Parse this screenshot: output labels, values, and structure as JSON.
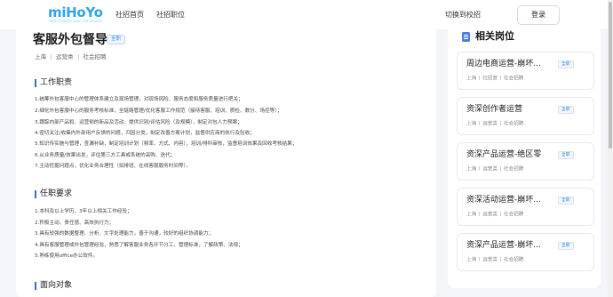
{
  "header": {
    "logo": {
      "brand": "miHoYo",
      "tagline": "TECH OTAKUS SAVE THE WORLD"
    },
    "nav": [
      {
        "label": "社招首页"
      },
      {
        "label": "社招职位"
      }
    ],
    "switch_label": "切换到校招",
    "login_label": "登录"
  },
  "job": {
    "title": "客服外包督导",
    "badge": "全职",
    "location": "上海",
    "category": "运营类",
    "recruit_type": "社会招聘",
    "duties_title": "工作职责",
    "duties": [
      "1.统筹外包客服中心的管理体系建立及现场管理，对现场风险、服务态度和服务质量进行把关；",
      "2.细化外包客服中心的服务考核标准，全链路管理/优化客服工作规范（接待客服、培训、质检、数分、场控等）；",
      "3.跟踪内部产品和、运营侧的新品及活动，提供识别/评估风险（及规模），制定对包人力预案；",
      "4.密切关注/收集内外部用户反馈的问题，归因分类，制定改善方案计划，监督供应商的执行及验收；",
      "5.知识传实施与管理，查漏补缺，制定培训计划（频率、方式、内容），培训/排科审核，监督培训效果及回收考核结果；",
      "6.从业务质量/效果出发，评估第三方工具或系统的采购、迭代；",
      "7.主动挖掘问题点，优化业务合理性（如排班、在线客服服务时间等）。"
    ],
    "requirements_title": "任职要求",
    "requirements": [
      "1.本科及以上学历，3年以上相关工作经验；",
      "2.积极主动、责任感、高效执行力；",
      "3.具有较强的数据整理、分析、文字处理能力，善于沟通，较好的组织协调能力；",
      "4.具有客服管理或外包管理经验，熟悉了解客服业务各环节分工、管理标准，了解政策、法规；",
      "5.熟练使用office办公软件。"
    ],
    "audience_title": "面向对象"
  },
  "sidebar": {
    "title": "相关岗位",
    "jobs": [
      {
        "title": "周边电商运营-崩坏...",
        "badge": "全职",
        "location": "上海",
        "category": "社招营",
        "type": "社会招聘"
      },
      {
        "title": "资深创作者运营",
        "badge": "全职",
        "location": "上海",
        "category": "运营类",
        "type": "社会招聘"
      },
      {
        "title": "资深产品运营-绝区零",
        "badge": "全职",
        "location": "上海",
        "category": "运营类",
        "type": "社会招聘"
      },
      {
        "title": "资深活动运营-崩坏...",
        "badge": "全职",
        "location": "上海",
        "category": "运营类",
        "type": "社会招聘"
      },
      {
        "title": "资深产品运营-崩坏...",
        "badge": "全职",
        "location": "上海",
        "category": "运营类",
        "type": "社会招聘"
      }
    ]
  },
  "colors": {
    "accent": "#2f6fd6",
    "brand": "#2ea6e8",
    "background": "#f3f5f9"
  }
}
